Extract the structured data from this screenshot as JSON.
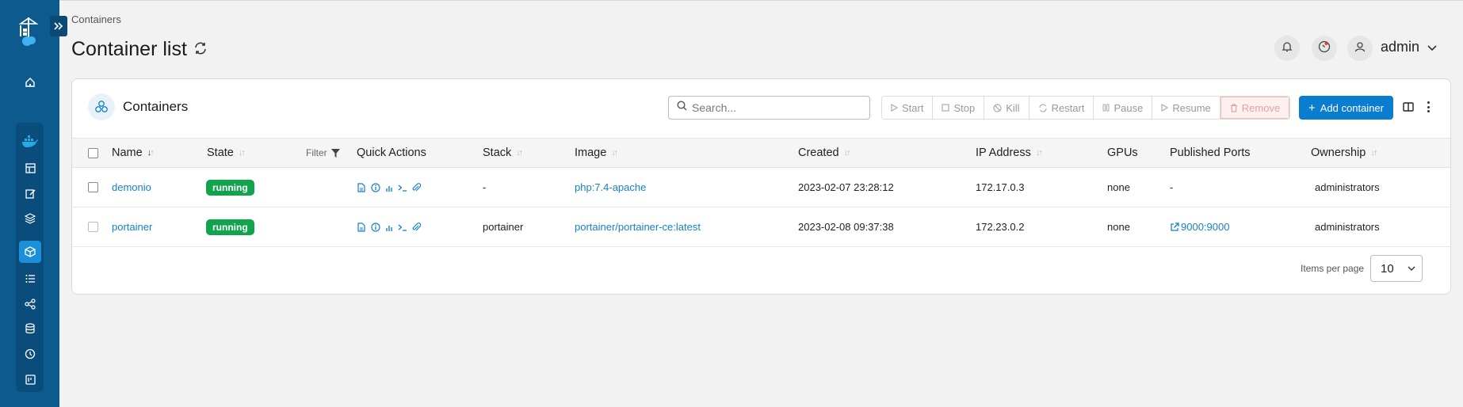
{
  "breadcrumb": "Containers",
  "page": {
    "title": "Container list"
  },
  "header": {
    "user": "admin"
  },
  "card": {
    "title": "Containers"
  },
  "search": {
    "placeholder": "Search..."
  },
  "actions": {
    "start": "Start",
    "stop": "Stop",
    "kill": "Kill",
    "restart": "Restart",
    "pause": "Pause",
    "resume": "Resume",
    "remove": "Remove",
    "add": "Add container"
  },
  "table": {
    "columns": {
      "name": "Name",
      "state": "State",
      "filter": "Filter",
      "quick_actions": "Quick Actions",
      "stack": "Stack",
      "image": "Image",
      "created": "Created",
      "ip": "IP Address",
      "gpus": "GPUs",
      "ports": "Published Ports",
      "ownership": "Ownership"
    },
    "rows": [
      {
        "name": "demonio",
        "state": "running",
        "stack": "-",
        "image": "php:7.4-apache",
        "created": "2023-02-07 23:28:12",
        "ip": "172.17.0.3",
        "gpus": "none",
        "ports": "-",
        "ownership": "administrators"
      },
      {
        "name": "portainer",
        "state": "running",
        "stack": "portainer",
        "image": "portainer/portainer-ce:latest",
        "created": "2023-02-08 09:37:38",
        "ip": "172.23.0.2",
        "gpus": "none",
        "ports": "9000:9000",
        "ownership": "administrators"
      }
    ]
  },
  "pagination": {
    "label": "Items per page",
    "value": "10"
  },
  "colors": {
    "sidebar": "#0d5a8f",
    "accent": "#0b7dd1",
    "running": "#12a34d",
    "link": "#1780c8"
  }
}
